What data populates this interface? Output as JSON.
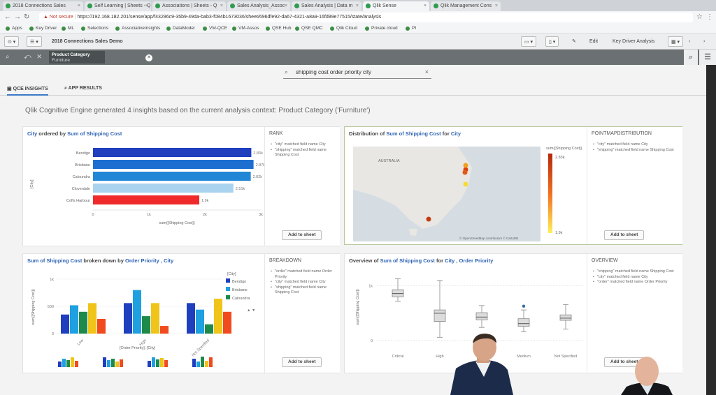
{
  "browser": {
    "tabs": [
      "2018 Connections Sales",
      "Self Learning | Sheets - Q",
      "Associations | Sheets - Q",
      "Sales Analysis_Assoc",
      "Sales Analysis | Data m",
      "Qlik Sense",
      "Qlik Management Cons"
    ],
    "url_warning": "Not secure",
    "url_path": "https://192.168.182.201/sense/app/f43286c9-35b9-49da-bab3-f084b1673036/sheet/696dfe92-da67-4321-a8a9-16fd89e77515/state/analysis",
    "bookmarks": [
      "Apps",
      "Key Driver",
      "ML",
      "Selections",
      "AssociativeInsights",
      "DataModel",
      "VM-QCE",
      "VM-Assos",
      "QSE Hub",
      "QSE QMC",
      "Qlik Cloud",
      "Private cloud",
      "PI"
    ]
  },
  "toolbar": {
    "app_title": "2018 Connections Sales Demo",
    "edit_label": "Edit",
    "sheet_label": "Key Driver Analysis"
  },
  "selection": {
    "field": "Product Category",
    "value": "Furniture"
  },
  "search": {
    "query": "shipping cost order priority city"
  },
  "tabs": {
    "insights": "QCE INSIGHTS",
    "results": "APP RESULTS"
  },
  "context_line": "Qlik Cognitive Engine generated 4 insights based on the current analysis context: Product Category ('Furniture')",
  "cards": {
    "rank": {
      "title_pre": "City",
      "title_mid": " ordered by ",
      "title_measure": "Sum of Shipping Cost",
      "side_header": "RANK",
      "notes": [
        "\"city\" matched field name City",
        "\"shipping\" matched field name Shipping Cost"
      ],
      "add_label": "Add to sheet"
    },
    "map": {
      "title_pre": "Distribution of ",
      "title_measure": "Sum of Shipping Cost",
      "title_mid": " for ",
      "title_dim": "City",
      "side_header": "POINTMAPDISTRIBUTION",
      "notes": [
        "\"city\" matched field name City",
        "\"shipping\" matched field name Shipping Cost"
      ],
      "add_label": "Add to sheet",
      "country_label": "AUSTRALIA",
      "legend_title": "sum([Shipping Cost])",
      "legend_max": "2.83k",
      "legend_min": "1.9k",
      "attribution": "© OpenStreetMap contributors © CartoDB"
    },
    "breakdown": {
      "title_measure": "Sum of Shipping Cost",
      "title_mid": " broken down by ",
      "title_dim": "Order Priority , City",
      "side_header": "BREAKDOWN",
      "notes": [
        "\"order\" matched field name Order Priority",
        "\"city\" matched field name City",
        "\"shipping\" matched field name Shipping Cost"
      ],
      "add_label": "Add to sheet",
      "legend_title": "[City]",
      "mini_label": "[Order Priority], [City]"
    },
    "overview": {
      "title_pre": "Overview of ",
      "title_measure": "Sum of Shipping Cost",
      "title_mid": " for ",
      "title_dim": "City , Order Priority",
      "side_header": "OVERVIEW",
      "notes": [
        "\"shipping\" matched field name Shipping Cost",
        "\"city\" matched field name City",
        "\"order\" matched field name Order Priority"
      ],
      "add_label": "Add to sheet"
    }
  },
  "chart_data": [
    {
      "type": "bar",
      "orientation": "horizontal",
      "categories": [
        "Bendigo",
        "Brisbane",
        "Caloundra",
        "Cloverdale",
        "Coffs Harbour"
      ],
      "values": [
        2830,
        2870,
        2820,
        2510,
        1900
      ],
      "data_labels": [
        "2.83k",
        "2.87k",
        "2.82k",
        "2.51k",
        "1.9k"
      ],
      "colors": [
        "#1f3fbf",
        "#1c6fd1",
        "#2286d6",
        "#a9d3ee",
        "#f02a2a"
      ],
      "xlabel": "sum([Shipping Cost])",
      "ylabel": "[City]",
      "xticks": [
        "0",
        "1k",
        "2k",
        "3k"
      ],
      "xlim": [
        0,
        3000
      ]
    },
    {
      "type": "bar",
      "categories": [
        "Low",
        "High",
        "Not Specified"
      ],
      "series": [
        {
          "name": "Bendigo",
          "color": "#1f3fbf",
          "values": [
            350,
            560,
            560
          ]
        },
        {
          "name": "Brisbane",
          "color": "#1fa0e0",
          "values": [
            520,
            800,
            440
          ]
        },
        {
          "name": "Caloundra",
          "color": "#1e8a4a",
          "values": [
            400,
            320,
            170
          ]
        },
        {
          "name": "Cloverdale",
          "color": "#f0c419",
          "values": [
            560,
            560,
            640
          ]
        },
        {
          "name": "Coffs Harbour",
          "color": "#f04a1e",
          "values": [
            270,
            140,
            400
          ]
        }
      ],
      "legend_visible": [
        "Bendigo",
        "Brisbane",
        "Caloundra"
      ],
      "ylabel": "sum([Shipping Cost])",
      "yticks": [
        "0",
        "500",
        "1k"
      ],
      "ylim": [
        0,
        1000
      ]
    },
    {
      "type": "boxplot",
      "categories": [
        "Critical",
        "High",
        "Low",
        "Medium",
        "Not Specified"
      ],
      "boxes": [
        {
          "min": 720,
          "q1": 800,
          "median": 860,
          "q3": 930,
          "max": 1130
        },
        {
          "min": 60,
          "q1": 350,
          "median": 500,
          "q3": 560,
          "max": 1100
        },
        {
          "min": 240,
          "q1": 380,
          "median": 430,
          "q3": 510,
          "max": 640
        },
        {
          "min": 160,
          "q1": 260,
          "median": 310,
          "q3": 400,
          "max": 560,
          "outliers": [
            630
          ]
        },
        {
          "min": 210,
          "q1": 370,
          "median": 410,
          "q3": 470,
          "max": 660
        }
      ],
      "ylabel": "sum([Shipping Cost])",
      "yticks": [
        "0",
        "1k"
      ],
      "ylim": [
        0,
        1200
      ]
    }
  ]
}
